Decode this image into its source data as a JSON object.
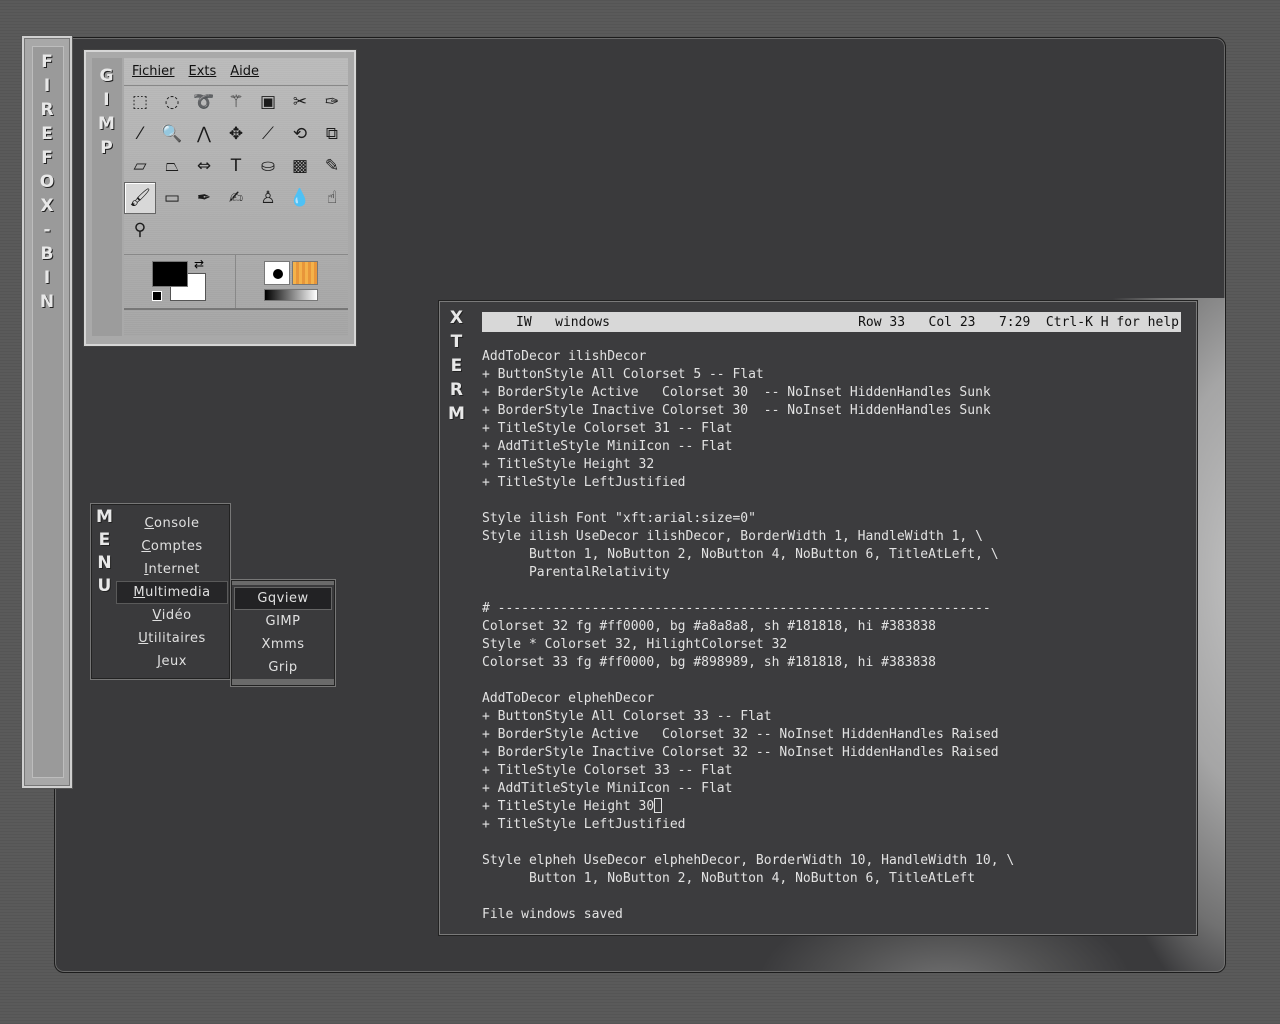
{
  "firefox": {
    "title_letters": [
      "F",
      "I",
      "R",
      "E",
      "F",
      "O",
      "X",
      "-",
      "B",
      "I",
      "N"
    ]
  },
  "gimp": {
    "title_letters": [
      "G",
      "I",
      "M",
      "P"
    ],
    "menu": [
      "Fichier",
      "Exts",
      "Aide"
    ],
    "tools": [
      {
        "name": "rect-select-icon",
        "glyph": "⬚"
      },
      {
        "name": "ellipse-select-icon",
        "glyph": "◌"
      },
      {
        "name": "lasso-icon",
        "glyph": "➰"
      },
      {
        "name": "magic-wand-icon",
        "glyph": "⚚"
      },
      {
        "name": "select-by-color-icon",
        "glyph": "▣"
      },
      {
        "name": "scissors-icon",
        "glyph": "✂"
      },
      {
        "name": "paths-icon",
        "glyph": "✑"
      },
      {
        "name": "color-picker-icon",
        "glyph": "⁄"
      },
      {
        "name": "zoom-icon",
        "glyph": "🔍"
      },
      {
        "name": "measure-icon",
        "glyph": "⋀"
      },
      {
        "name": "move-icon",
        "glyph": "✥"
      },
      {
        "name": "crop-icon",
        "glyph": "⟋"
      },
      {
        "name": "rotate-icon",
        "glyph": "⟲"
      },
      {
        "name": "scale-icon",
        "glyph": "⧉"
      },
      {
        "name": "shear-icon",
        "glyph": "▱"
      },
      {
        "name": "perspective-icon",
        "glyph": "⏢"
      },
      {
        "name": "flip-icon",
        "glyph": "⇔"
      },
      {
        "name": "text-icon",
        "glyph": "T"
      },
      {
        "name": "bucket-fill-icon",
        "glyph": "⛀"
      },
      {
        "name": "blend-icon",
        "glyph": "▩"
      },
      {
        "name": "pencil-icon",
        "glyph": "✎"
      },
      {
        "name": "paintbrush-icon",
        "glyph": "🖌"
      },
      {
        "name": "eraser-icon",
        "glyph": "▭"
      },
      {
        "name": "airbrush-icon",
        "glyph": "✒"
      },
      {
        "name": "ink-icon",
        "glyph": "✍"
      },
      {
        "name": "clone-icon",
        "glyph": "♙"
      },
      {
        "name": "blur-icon",
        "glyph": "💧"
      },
      {
        "name": "smudge-icon",
        "glyph": "☝"
      },
      {
        "name": "dodge-burn-icon",
        "glyph": "⚲"
      }
    ]
  },
  "xterm": {
    "title_letters": [
      "X",
      "T",
      "E",
      "R",
      "M"
    ],
    "status_left": "IW   windows",
    "status_right": "Row 33   Col 23   7:29  Ctrl-K H for help",
    "lines": [
      "AddToDecor ilishDecor",
      "+ ButtonStyle All Colorset 5 -- Flat",
      "+ BorderStyle Active   Colorset 30  -- NoInset HiddenHandles Sunk",
      "+ BorderStyle Inactive Colorset 30  -- NoInset HiddenHandles Sunk",
      "+ TitleStyle Colorset 31 -- Flat",
      "+ AddTitleStyle MiniIcon -- Flat",
      "+ TitleStyle Height 32",
      "+ TitleStyle LeftJustified",
      "",
      "Style ilish Font \"xft:arial:size=0\"",
      "Style ilish UseDecor ilishDecor, BorderWidth 1, HandleWidth 1, \\",
      "      Button 1, NoButton 2, NoButton 4, NoButton 6, TitleAtLeft, \\",
      "      ParentalRelativity",
      "",
      "# ---------------------------------------------------------------",
      "Colorset 32 fg #ff0000, bg #a8a8a8, sh #181818, hi #383838",
      "Style * Colorset 32, HilightColorset 32",
      "Colorset 33 fg #ff0000, bg #898989, sh #181818, hi #383838",
      "",
      "AddToDecor elphehDecor",
      "+ ButtonStyle All Colorset 33 -- Flat",
      "+ BorderStyle Active   Colorset 32 -- NoInset HiddenHandles Raised",
      "+ BorderStyle Inactive Colorset 32 -- NoInset HiddenHandles Raised",
      "+ TitleStyle Colorset 33 -- Flat",
      "+ AddTitleStyle MiniIcon -- Flat",
      "+ TitleStyle Height 30",
      "+ TitleStyle LeftJustified",
      "",
      "Style elpheh UseDecor elphehDecor, BorderWidth 10, HandleWidth 10, \\",
      "      Button 1, NoButton 2, NoButton 4, NoButton 6, TitleAtLeft",
      "",
      "File windows saved"
    ]
  },
  "menu": {
    "title_letters": [
      "M",
      "E",
      "N",
      "U"
    ],
    "items": [
      {
        "label": "Console",
        "key": "C"
      },
      {
        "label": "Comptes",
        "key": "C"
      },
      {
        "label": "Internet",
        "key": "I"
      },
      {
        "label": "Multimedia",
        "key": "M"
      },
      {
        "label": "Vidéo",
        "key": "V"
      },
      {
        "label": "Utilitaires",
        "key": "U"
      },
      {
        "label": "Jeux",
        "key": "J"
      }
    ],
    "selected_index": 3,
    "submenu": {
      "items": [
        "Gqview",
        "GIMP",
        "Xmms",
        "Grip"
      ],
      "selected_index": 0
    }
  }
}
